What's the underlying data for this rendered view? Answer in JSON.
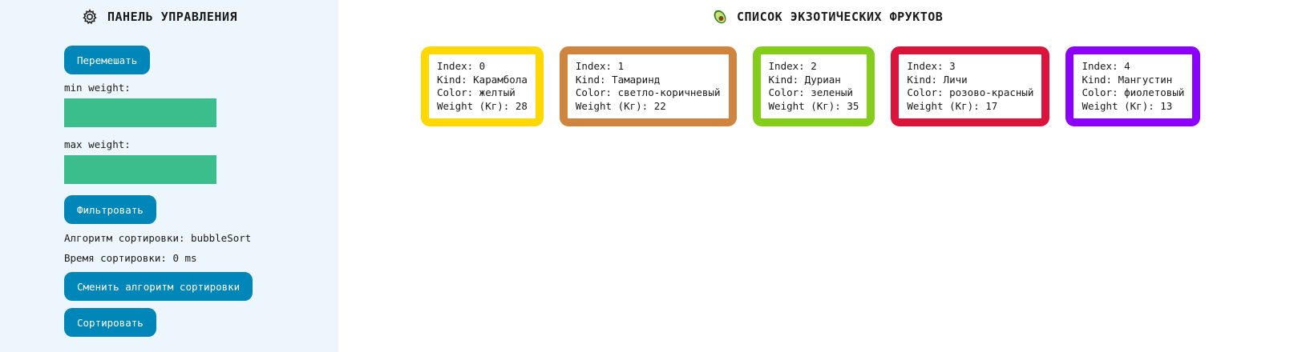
{
  "panel": {
    "title": "ПАНЕЛЬ УПРАВЛЕНИЯ",
    "icon": "gear-icon",
    "shuffle_label": "Перемешать",
    "min_weight_label": "min weight:",
    "min_weight_value": "",
    "max_weight_label": "max weight:",
    "max_weight_value": "",
    "filter_label": "Фильтровать",
    "sort_algorithm_text": "Алгоритм сортировки: bubbleSort",
    "sort_time_text": "Время сортировки: 0 ms",
    "change_algorithm_label": "Сменить алгоритм сортировки",
    "sort_label": "Сортировать",
    "colors": {
      "background": "#eef6fd",
      "button": "#0086b8",
      "input": "#3cbe8c"
    }
  },
  "list": {
    "title": "СПИСОК ЭКЗОТИЧЕСКИХ ФРУКТОВ",
    "icon": "avocado-icon",
    "fruits": [
      {
        "index": "Index: 0",
        "kind": "Kind: Карамбола",
        "color": "Color: желтый",
        "weight": "Weight (Кг): 28",
        "border": "#ffd800"
      },
      {
        "index": "Index: 1",
        "kind": "Kind: Тамаринд",
        "color": "Color: светло-коричневый",
        "weight": "Weight (Кг): 22",
        "border": "#cd853f"
      },
      {
        "index": "Index: 2",
        "kind": "Kind: Дуриан",
        "color": "Color: зеленый",
        "weight": "Weight (Кг): 35",
        "border": "#84cd1b"
      },
      {
        "index": "Index: 3",
        "kind": "Kind: Личи",
        "color": "Color: розово-красный",
        "weight": "Weight (Кг): 17",
        "border": "#dc143c"
      },
      {
        "index": "Index: 4",
        "kind": "Kind: Мангустин",
        "color": "Color: фиолетовый",
        "weight": "Weight (Кг): 13",
        "border": "#8b00ff"
      }
    ]
  }
}
